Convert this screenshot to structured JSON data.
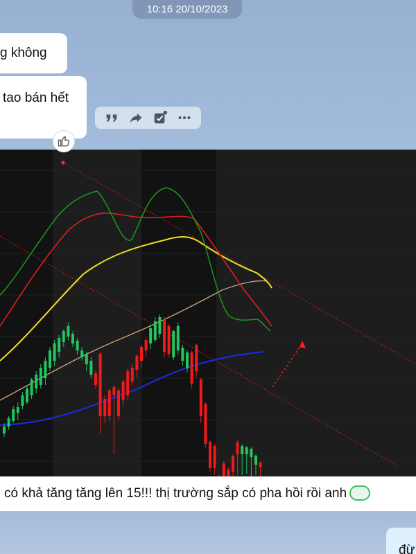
{
  "timestamp": "10:16 20/10/2023",
  "messages": {
    "msg1": "g không",
    "msg2": "tao bán hết",
    "msg3": "có khả tăng tăng lên 15!!! thị trường sắp có pha hồi rồi anh",
    "msg4": "đừ"
  },
  "toolbar": {
    "icons": [
      "quote-icon",
      "forward-icon",
      "task-icon",
      "more-icon"
    ]
  },
  "colors": {
    "up_candle": "#22c55e",
    "down_candle": "#ef1a1a",
    "ma_fast": "#1a9a1a",
    "ma_mid": "#e02020",
    "ma_slow": "#f0e020",
    "ma_long": "#c9a27a",
    "ma_longest": "#1a2ad8",
    "trend_line": "#e02020"
  },
  "chart": {
    "candles": [
      [
        0,
        395,
        415,
        400,
        410
      ],
      [
        1,
        385,
        405,
        388,
        400
      ],
      [
        2,
        370,
        395,
        375,
        392
      ],
      [
        3,
        365,
        390,
        372,
        380
      ],
      [
        4,
        350,
        375,
        355,
        370
      ],
      [
        5,
        340,
        368,
        345,
        365
      ],
      [
        6,
        330,
        360,
        332,
        355
      ],
      [
        7,
        320,
        352,
        325,
        345
      ],
      [
        8,
        310,
        345,
        315,
        340
      ],
      [
        9,
        300,
        340,
        305,
        330
      ],
      [
        10,
        285,
        320,
        290,
        315
      ],
      [
        11,
        275,
        312,
        280,
        305
      ],
      [
        12,
        268,
        300,
        272,
        292
      ],
      [
        13,
        260,
        285,
        262,
        278
      ],
      [
        14,
        250,
        275,
        255,
        270
      ],
      [
        15,
        262,
        285,
        266,
        280
      ],
      [
        16,
        272,
        296,
        276,
        290
      ],
      [
        17,
        285,
        305,
        290,
        300
      ],
      [
        18,
        292,
        320,
        295,
        310
      ],
      [
        19,
        300,
        330,
        305,
        325
      ],
      [
        20,
        320,
        345,
        323,
        340
      ],
      [
        21,
        292,
        410,
        295,
        385
      ],
      [
        22,
        355,
        395,
        360,
        385
      ],
      [
        23,
        345,
        392,
        348,
        385
      ],
      [
        24,
        340,
        440,
        343,
        355
      ],
      [
        25,
        345,
        390,
        348,
        385
      ],
      [
        26,
        332,
        370,
        335,
        362
      ],
      [
        27,
        316,
        362,
        320,
        355
      ],
      [
        28,
        310,
        340,
        315,
        335
      ],
      [
        29,
        295,
        330,
        298,
        318
      ],
      [
        30,
        282,
        315,
        285,
        305
      ],
      [
        31,
        272,
        300,
        275,
        290
      ],
      [
        32,
        255,
        288,
        258,
        280
      ],
      [
        33,
        242,
        278,
        248,
        275
      ],
      [
        34,
        238,
        272,
        242,
        266
      ],
      [
        35,
        242,
        300,
        245,
        292
      ],
      [
        36,
        252,
        300,
        255,
        295
      ],
      [
        37,
        260,
        304,
        262,
        300
      ],
      [
        38,
        250,
        296,
        255,
        290
      ],
      [
        39,
        282,
        312,
        286,
        305
      ],
      [
        40,
        290,
        322,
        293,
        316
      ],
      [
        41,
        290,
        345,
        293,
        338
      ],
      [
        42,
        280,
        330,
        282,
        320
      ],
      [
        43,
        330,
        395,
        332,
        385
      ],
      [
        44,
        365,
        430,
        367,
        425
      ],
      [
        45,
        420,
        465,
        422,
        460
      ],
      [
        46,
        425,
        470,
        428,
        460
      ],
      [
        47,
        470,
        510,
        472,
        505
      ],
      [
        48,
        450,
        525,
        453,
        480
      ],
      [
        49,
        460,
        495,
        462,
        475
      ],
      [
        50,
        440,
        508,
        443,
        465
      ],
      [
        51,
        420,
        470,
        423,
        440
      ],
      [
        52,
        425,
        470,
        428,
        440
      ],
      [
        53,
        428,
        468,
        430,
        440
      ],
      [
        54,
        430,
        475,
        432,
        444
      ],
      [
        55,
        440,
        470,
        442,
        455
      ],
      [
        56,
        450,
        482,
        452,
        458
      ],
      [
        57,
        480,
        530,
        482,
        522
      ],
      [
        58,
        510,
        560,
        512,
        555
      ]
    ]
  }
}
